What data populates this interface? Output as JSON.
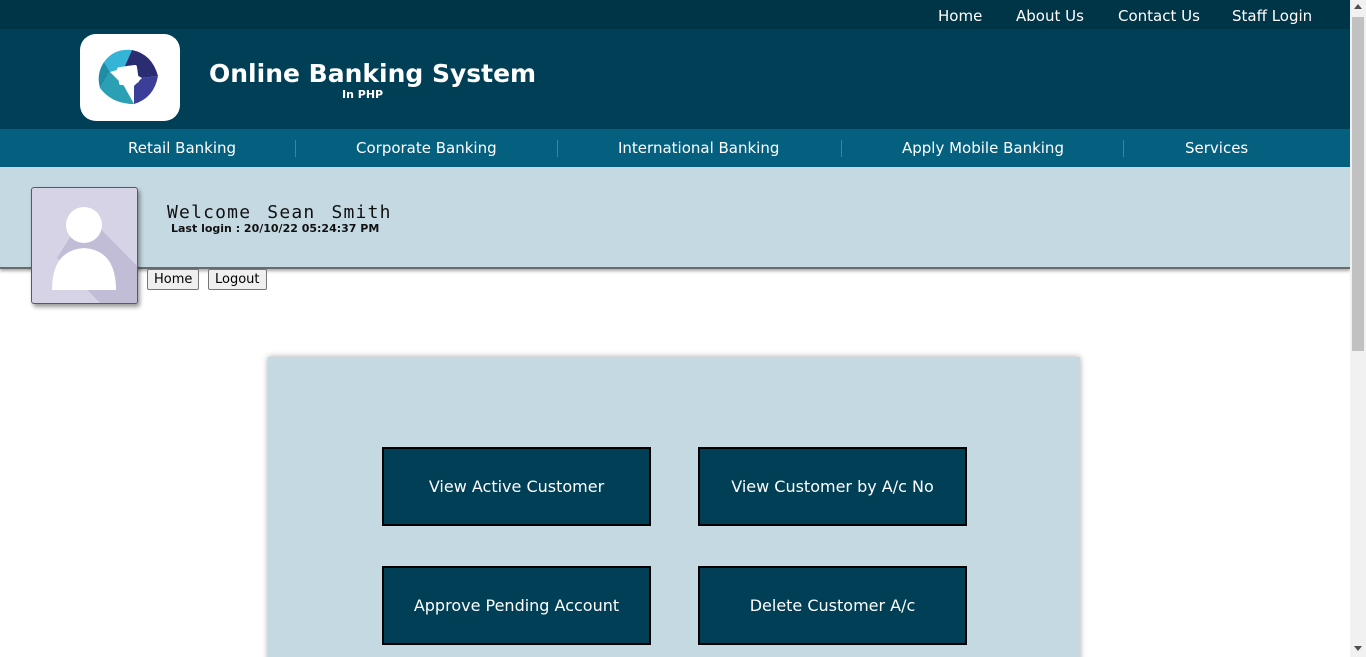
{
  "top_nav": {
    "items": [
      {
        "label": "Home"
      },
      {
        "label": "About Us"
      },
      {
        "label": "Contact Us"
      },
      {
        "label": "Staff Login"
      }
    ]
  },
  "header": {
    "logo": "bank-logo",
    "title": "Online Banking System",
    "subtitle": "In PHP"
  },
  "main_nav": {
    "items": [
      {
        "label": "Retail Banking"
      },
      {
        "label": "Corporate Banking"
      },
      {
        "label": "International Banking"
      },
      {
        "label": "Apply Mobile Banking"
      },
      {
        "label": "Services"
      }
    ]
  },
  "user": {
    "avatar": "user-avatar-icon",
    "welcome": "Welcome  Sean  Smith",
    "last_login": "Last login : 20/10/22 05:24:37 PM",
    "home_button": "Home",
    "logout_button": "Logout"
  },
  "actions": [
    {
      "label": "View Active Customer"
    },
    {
      "label": "View Customer by A/c No"
    },
    {
      "label": "Approve Pending Account"
    },
    {
      "label": "Delete Customer A/c"
    }
  ],
  "colors": {
    "top_bar": "#003447",
    "header": "#003f56",
    "main_nav": "#05607f",
    "panel": "#c5d9e2",
    "action_button": "#003f56"
  }
}
